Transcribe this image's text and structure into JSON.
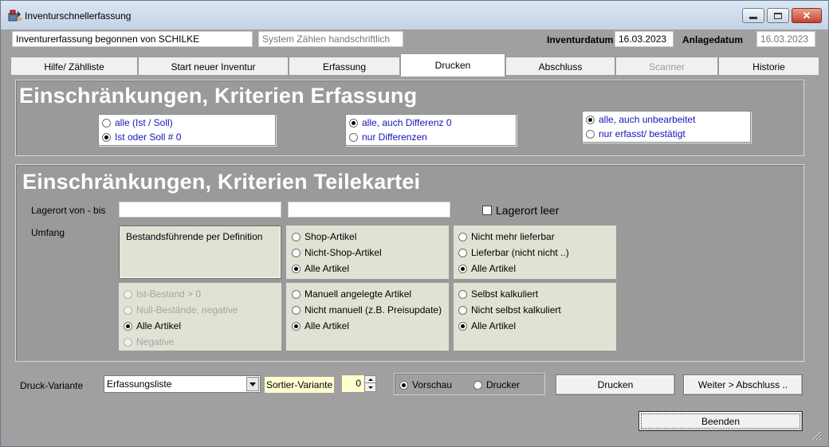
{
  "window": {
    "title": "Inventurschnellerfassung",
    "colors": {
      "title_bar": "#c3d3e6",
      "client_bg": "#a0a0a0",
      "panel_title": "#ffffff",
      "option_blue": "#1515b8",
      "beige": "#e2e2d4",
      "spin_yellow": "#ffffd0"
    }
  },
  "header": {
    "started_by": "Inventurerfassung begonnen von SCHILKE",
    "system_mode": "System Zählen handschriftlich",
    "inventory_date_label": "Inventurdatum",
    "inventory_date": "16.03.2023",
    "creation_date_label": "Anlagedatum",
    "creation_date": "16.03.2023"
  },
  "tabs": [
    {
      "label": "Hilfe/ Zählliste",
      "active": false,
      "enabled": true
    },
    {
      "label": "Start neuer Inventur",
      "active": false,
      "enabled": true
    },
    {
      "label": "Erfassung",
      "active": false,
      "enabled": true
    },
    {
      "label": "Drucken",
      "active": true,
      "enabled": true
    },
    {
      "label": "Abschluss",
      "active": false,
      "enabled": true
    },
    {
      "label": "Scanner",
      "active": false,
      "enabled": false
    },
    {
      "label": "Historie",
      "active": false,
      "enabled": true
    }
  ],
  "erfassung": {
    "title": "Einschränkungen, Kriterien Erfassung",
    "group1": [
      {
        "label": "alle (Ist / Soll)",
        "checked": false
      },
      {
        "label": "Ist oder Soll # 0",
        "checked": true
      }
    ],
    "group2": [
      {
        "label": "alle, auch Differenz 0",
        "checked": true
      },
      {
        "label": "nur Differenzen",
        "checked": false
      }
    ],
    "group3": [
      {
        "label": "alle, auch unbearbeitet",
        "checked": true
      },
      {
        "label": "nur erfasst/ bestätigt",
        "checked": false
      }
    ]
  },
  "teilekartei": {
    "title": "Einschränkungen, Kriterien Teilekartei",
    "lagerort_label": "Lagerort von - bis",
    "lagerort_from": "",
    "lagerort_to": "",
    "lagerort_leer_label": "Lagerort leer",
    "lagerort_leer_checked": false,
    "umfang_label": "Umfang",
    "bestand_def_label": "Bestandsführende per Definition",
    "shop_group": [
      {
        "label": "Shop-Artikel",
        "checked": false
      },
      {
        "label": "Nicht-Shop-Artikel",
        "checked": false
      },
      {
        "label": "Alle Artikel",
        "checked": true
      }
    ],
    "liefer_group": [
      {
        "label": "Nicht mehr lieferbar",
        "checked": false
      },
      {
        "label": "Lieferbar (nicht nicht ..)",
        "checked": false
      },
      {
        "label": "Alle Artikel",
        "checked": true
      }
    ],
    "bestand_group": [
      {
        "label": "Ist-Bestand > 0",
        "checked": false,
        "enabled": false
      },
      {
        "label": "Null-Bestände, negative",
        "checked": false,
        "enabled": false
      },
      {
        "label": "Alle Artikel",
        "checked": true,
        "enabled": true
      },
      {
        "label": "Negative",
        "checked": false,
        "enabled": false
      }
    ],
    "manuell_group": [
      {
        "label": "Manuell angelegte Artikel",
        "checked": false
      },
      {
        "label": "Nicht manuell (z.B. Preisupdate)",
        "checked": false
      },
      {
        "label": "Alle Artikel",
        "checked": true
      }
    ],
    "kalk_group": [
      {
        "label": "Selbst kalkuliert",
        "checked": false
      },
      {
        "label": "Nicht selbst kalkuliert",
        "checked": false
      },
      {
        "label": "Alle Artikel",
        "checked": true
      }
    ]
  },
  "footer": {
    "druck_variante_label": "Druck-Variante",
    "druck_variante_value": "Erfassungsliste",
    "sortier_variante_label": "Sortier-Variante",
    "sortier_variante_value": "0",
    "output_options": [
      {
        "label": "Vorschau",
        "checked": true
      },
      {
        "label": "Drucker",
        "checked": false
      }
    ],
    "print_button": "Drucken",
    "next_button": "Weiter > Abschluss ..",
    "exit_button": "Beenden"
  }
}
